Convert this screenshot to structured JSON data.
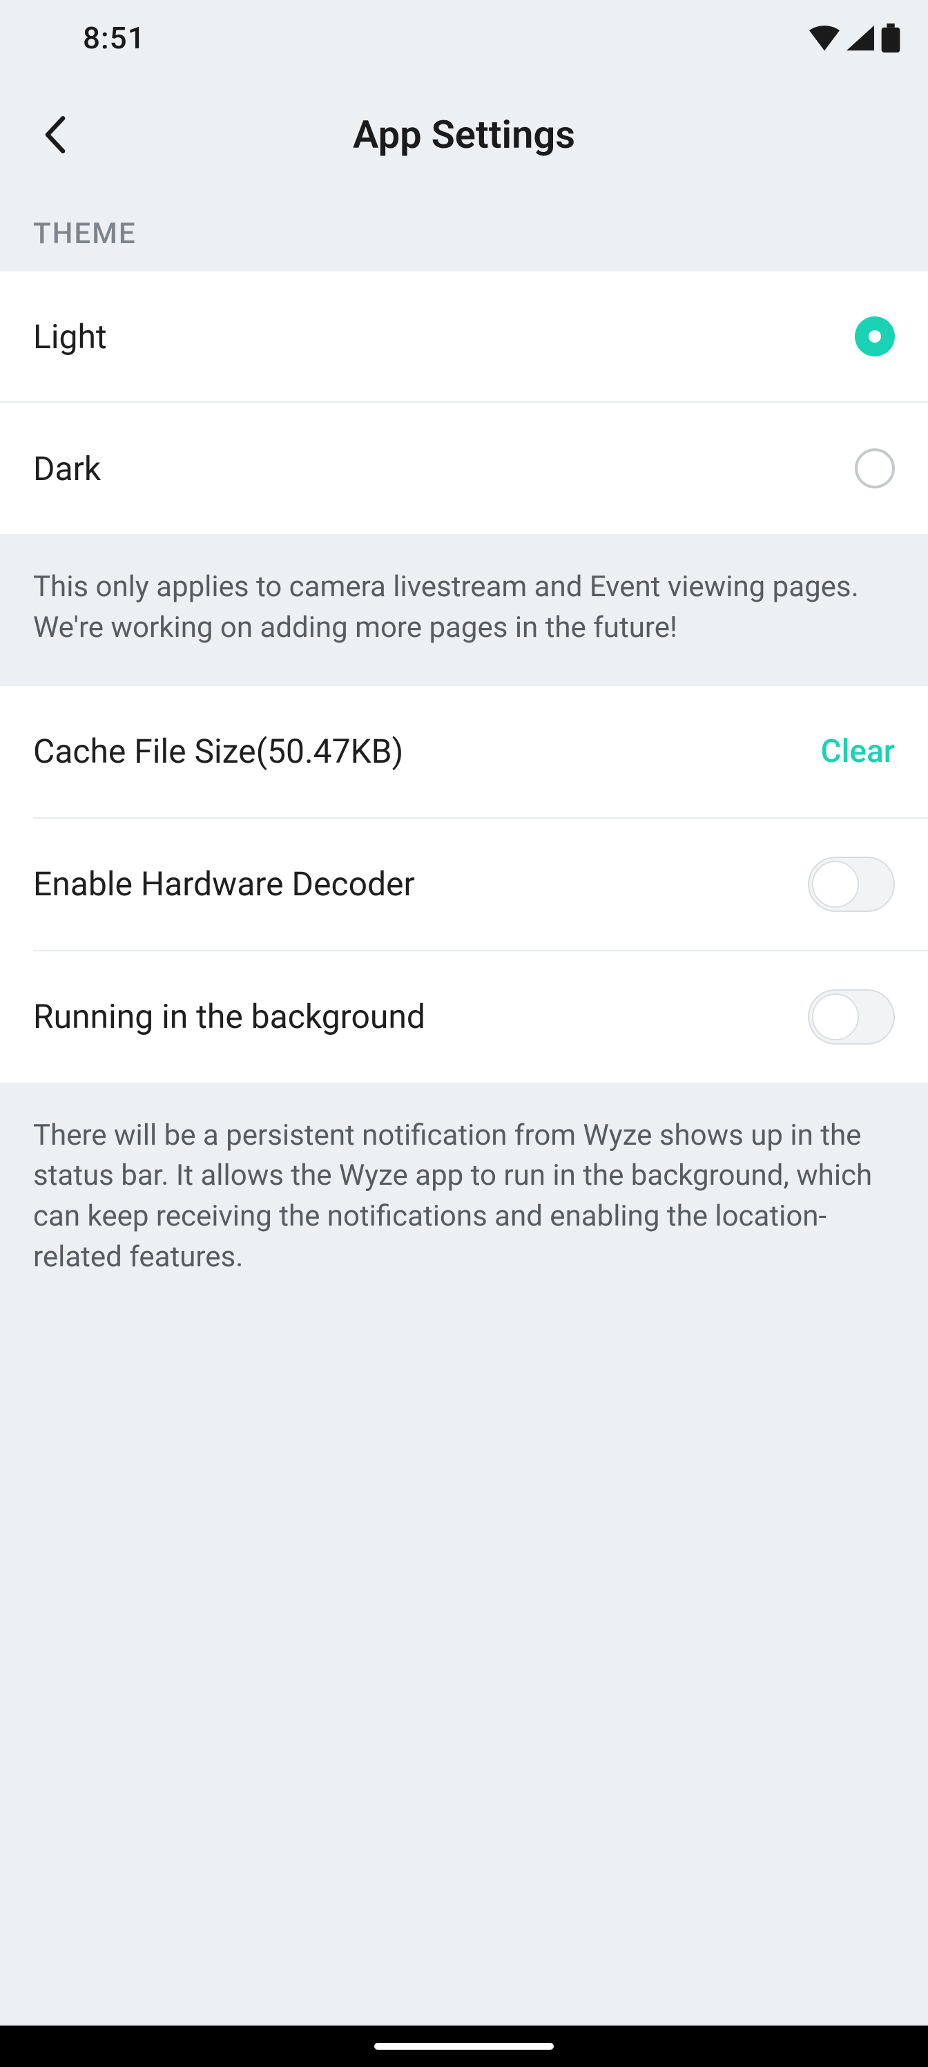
{
  "status_bar": {
    "time": "8:51"
  },
  "header": {
    "title": "App Settings"
  },
  "theme_section": {
    "header": "THEME",
    "options": [
      {
        "label": "Light",
        "selected": true
      },
      {
        "label": "Dark",
        "selected": false
      }
    ],
    "note": "This only applies to camera livestream and Event viewing pages. We're working on adding more pages in the future!"
  },
  "settings": {
    "cache": {
      "label": "Cache File Size(50.47KB)",
      "action": "Clear"
    },
    "hardware_decoder": {
      "label": "Enable Hardware Decoder",
      "enabled": false
    },
    "background": {
      "label": "Running in the background",
      "enabled": false
    },
    "background_note": "There will be a persistent notification from Wyze shows up in the status bar. It allows the Wyze app to run in the background, which can keep receiving the notifications and enabling the location-related features."
  },
  "colors": {
    "accent": "#1ad2b4",
    "bg": "#EDF0F2",
    "text_muted": "#565c62"
  }
}
